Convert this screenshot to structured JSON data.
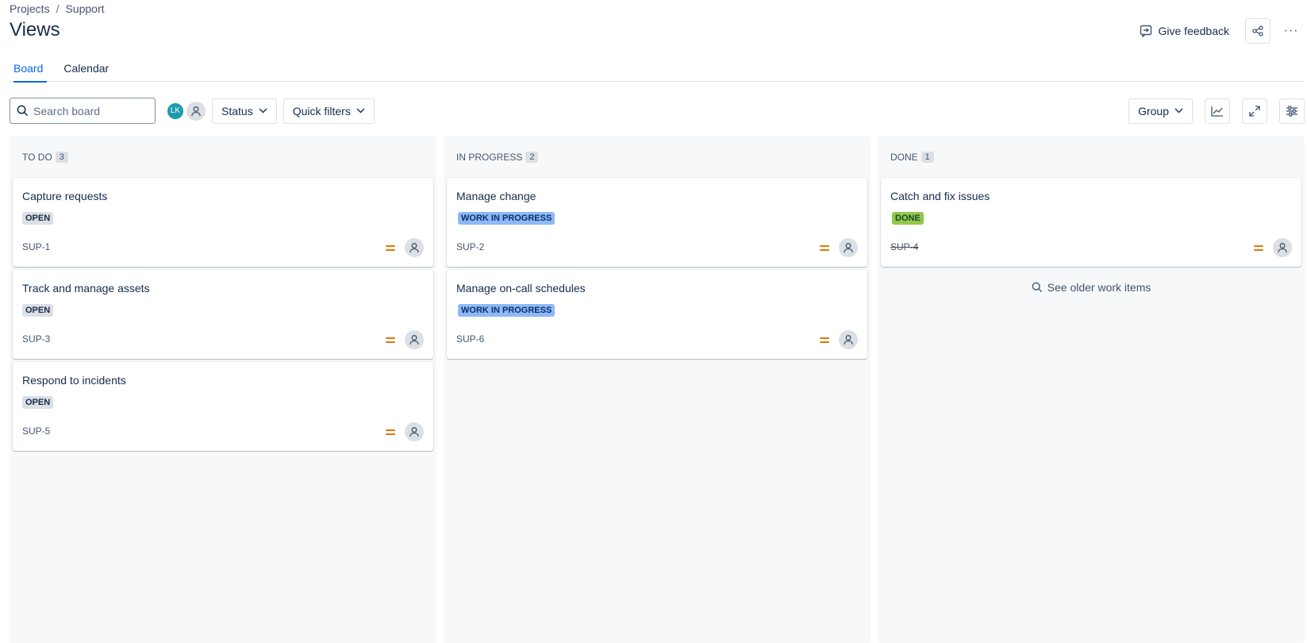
{
  "breadcrumb": {
    "project": "Projects",
    "separator": "/",
    "space": "Support"
  },
  "page": {
    "title": "Views"
  },
  "actions": {
    "feedback_label": "Give feedback",
    "more_glyph": "···"
  },
  "tabs": [
    {
      "label": "Board",
      "active": true
    },
    {
      "label": "Calendar",
      "active": false
    }
  ],
  "toolbar": {
    "search_placeholder": "Search board",
    "avatar_initials": "LK",
    "status_label": "Status",
    "quick_filters_label": "Quick filters",
    "group_label": "Group"
  },
  "columns": [
    {
      "name": "TO DO",
      "count": "3",
      "cards": [
        {
          "title": "Capture requests",
          "status": "OPEN",
          "key": "SUP-1"
        },
        {
          "title": "Track and manage assets",
          "status": "OPEN",
          "key": "SUP-3"
        },
        {
          "title": "Respond to incidents",
          "status": "OPEN",
          "key": "SUP-5"
        }
      ]
    },
    {
      "name": "IN PROGRESS",
      "count": "2",
      "cards": [
        {
          "title": "Manage change",
          "status": "WORK IN PROGRESS",
          "key": "SUP-2"
        },
        {
          "title": "Manage on-call schedules",
          "status": "WORK IN PROGRESS",
          "key": "SUP-6"
        }
      ]
    },
    {
      "name": "DONE",
      "count": "1",
      "cards": [
        {
          "title": "Catch and fix issues",
          "status": "DONE",
          "key": "SUP-4"
        }
      ],
      "older_label": "See older work items"
    }
  ],
  "colors": {
    "accent": "#0c66e4",
    "priority_medium": "#e2740b",
    "wip_badge": "#8fb8f6",
    "done_badge": "#94c748",
    "open_badge": "#dcdfe4"
  }
}
